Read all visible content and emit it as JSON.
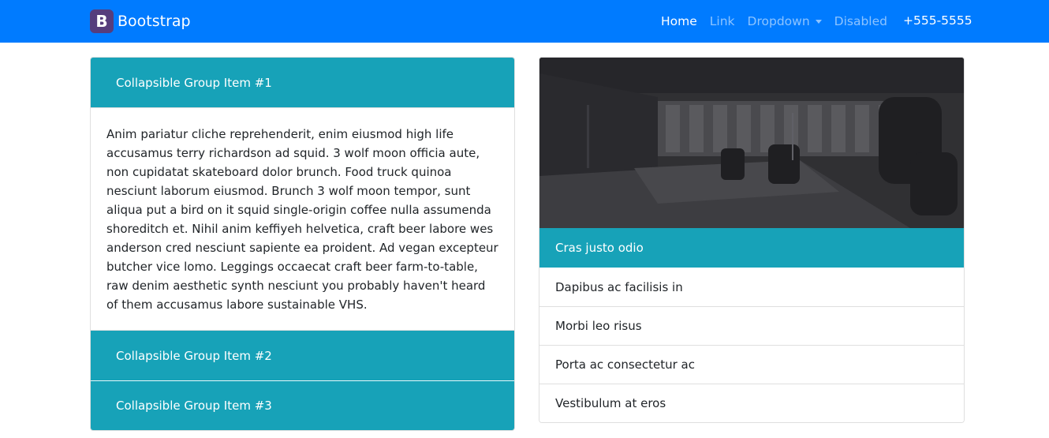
{
  "navbar": {
    "brand_letter": "B",
    "brand_text": "Bootstrap",
    "items": [
      {
        "label": "Home",
        "state": "active"
      },
      {
        "label": "Link",
        "state": "normal"
      },
      {
        "label": "Dropdown",
        "state": "dropdown"
      },
      {
        "label": "Disabled",
        "state": "disabled"
      }
    ],
    "phone": "+555-5555",
    "background": "#007bff",
    "brand_logo_color": "#563d7c"
  },
  "accordion": {
    "header_color": "#17a2b8",
    "items": [
      {
        "title": "Collapsible Group Item #1",
        "expanded": true
      },
      {
        "title": "Collapsible Group Item #2",
        "expanded": false
      },
      {
        "title": "Collapsible Group Item #3",
        "expanded": false
      }
    ],
    "body_text": "Anim pariatur cliche reprehenderit, enim eiusmod high life accusamus terry richardson ad squid. 3 wolf moon officia aute, non cupidatat skateboard dolor brunch. Food truck quinoa nesciunt laborum eiusmod. Brunch 3 wolf moon tempor, sunt aliqua put a bird on it squid single-origin coffee nulla assumenda shoreditch et. Nihil anim keffiyeh helvetica, craft beer labore wes anderson cred nesciunt sapiente ea proident. Ad vegan excepteur butcher vice lomo. Leggings occaecat craft beer farm-to-table, raw denim aesthetic synth nesciunt you probably haven't heard of them accusamus labore sustainable VHS."
  },
  "card": {
    "header": "Cras justo odio",
    "list": [
      "Dapibus ac facilisis in",
      "Morbi leo risus",
      "Porta ac consectetur ac",
      "Vestibulum at eros"
    ]
  }
}
